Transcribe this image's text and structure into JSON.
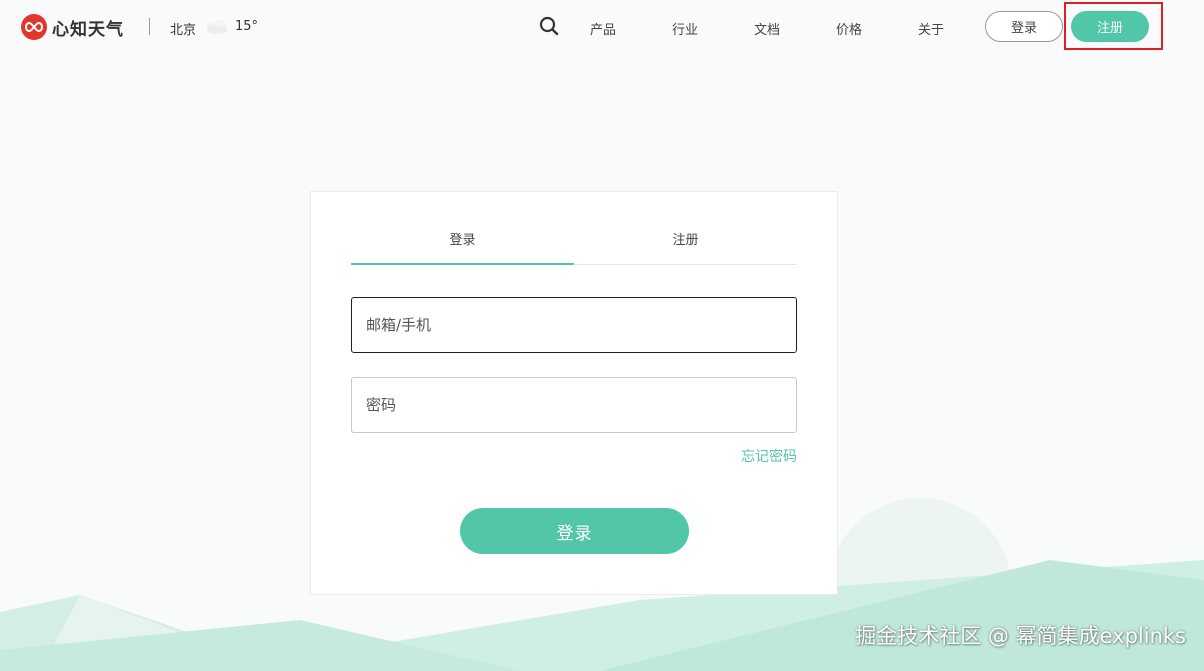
{
  "brand": {
    "name": "心知天气",
    "accent": "#52c6a8",
    "logo_color": "#e0362c"
  },
  "weather": {
    "city": "北京",
    "icon": "cloudy-icon",
    "temperature": "15°"
  },
  "nav": {
    "links": [
      "产品",
      "行业",
      "文档",
      "价格",
      "关于"
    ],
    "login_label": "登录",
    "register_label": "注册"
  },
  "form": {
    "tabs": [
      {
        "label": "登录",
        "active": true
      },
      {
        "label": "注册",
        "active": false
      }
    ],
    "email_placeholder": "邮箱/手机",
    "email_value": "",
    "password_placeholder": "密码",
    "password_value": "",
    "forgot_label": "忘记密码",
    "submit_label": "登录"
  },
  "highlight": {
    "target": "nav-register-button",
    "color": "#e02020"
  },
  "watermark": "掘金技术社区 @ 幂简集成explinks"
}
